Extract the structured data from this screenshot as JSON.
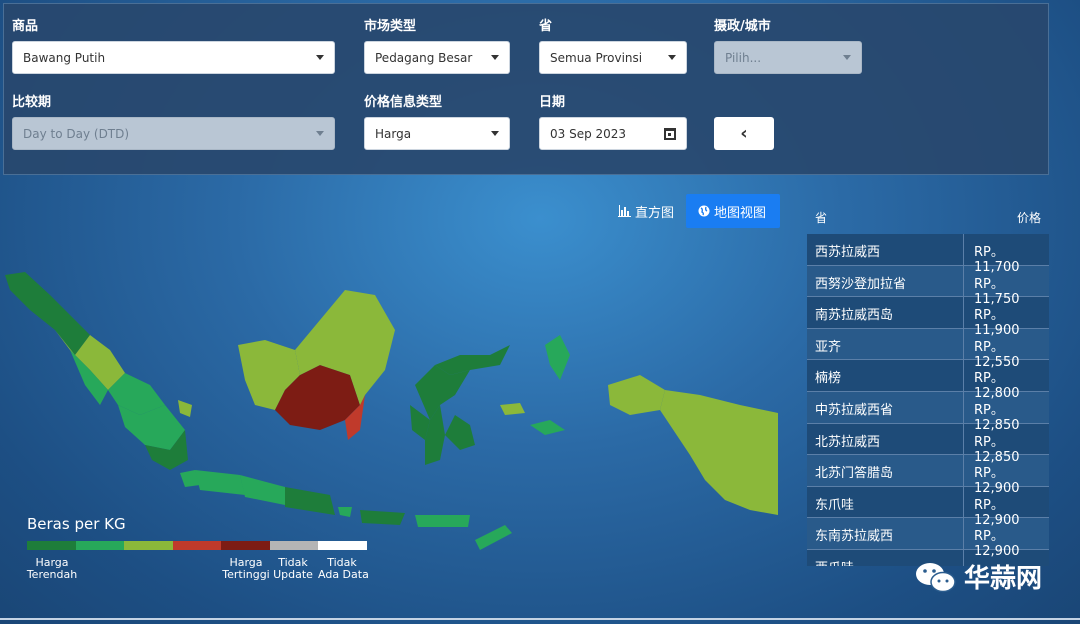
{
  "filters": {
    "commodity": {
      "label": "商品",
      "value": "Bawang Putih"
    },
    "market_type": {
      "label": "市场类型",
      "value": "Pedagang Besar"
    },
    "province": {
      "label": "省",
      "value": "Semua Provinsi"
    },
    "regency": {
      "label": "摄政/城市",
      "placeholder": "Pilih..."
    },
    "compare_period": {
      "label": "比较期",
      "value": "Day to Day (DTD)"
    },
    "price_info_type": {
      "label": "价格信息类型",
      "value": "Harga"
    },
    "date": {
      "label": "日期",
      "value": "03 Sep 2023"
    }
  },
  "views": {
    "histogram": "直方图",
    "map": "地图视图"
  },
  "legend": {
    "title": "Beras per KG",
    "colors": [
      "#1e7d3a",
      "#27a85a",
      "#8bb83a",
      "#c03a2b",
      "#7d1c14",
      "#b5b5b5",
      "#ffffff"
    ],
    "labels": {
      "lowest": "Harga\nTerendah",
      "highest": "Harga\nTertinggi",
      "not_updated": "Tidak\nUpdate",
      "no_data": "Tidak\nAda Data"
    }
  },
  "table": {
    "headers": {
      "province": "省",
      "price": "价格"
    },
    "rows": [
      {
        "province": "西苏拉威西",
        "price": "RP。11,700"
      },
      {
        "province": "西努沙登加拉省",
        "price": "RP。11,750"
      },
      {
        "province": "南苏拉威西岛",
        "price": "RP。11,900"
      },
      {
        "province": "亚齐",
        "price": "RP。12,550"
      },
      {
        "province": "楠榜",
        "price": "RP。12,800"
      },
      {
        "province": "中苏拉威西省",
        "price": "RP。12,850"
      },
      {
        "province": "北苏拉威西",
        "price": "RP。12,850"
      },
      {
        "province": "北苏门答腊岛",
        "price": "RP。12,900"
      },
      {
        "province": "东爪哇",
        "price": "RP。12,900"
      },
      {
        "province": "东南苏拉威西",
        "price": "RP。12,900"
      },
      {
        "province": "西爪哇",
        "price": ""
      }
    ]
  },
  "watermark": "华蒜网"
}
